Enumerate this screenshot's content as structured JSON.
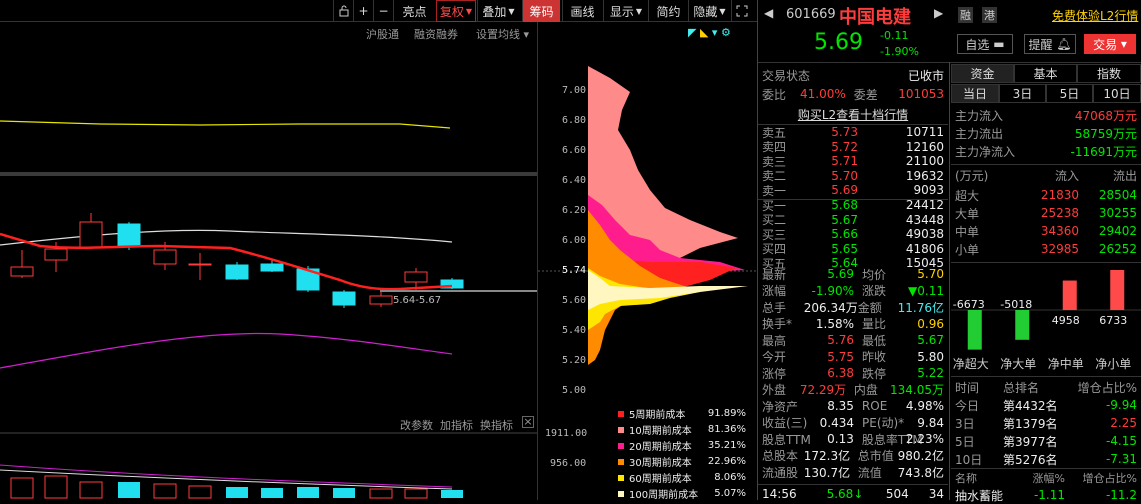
{
  "toolbar": {
    "items": [
      "亮点",
      "复权",
      "叠加",
      "筹码",
      "画线",
      "显示",
      "简约",
      "隐藏"
    ],
    "icons": [
      "lock-icon",
      "plus-icon",
      "minus-icon"
    ]
  },
  "chart_toolbar": [
    "沪股通",
    "融资融券",
    "设置均线"
  ],
  "indicator_toolbar": [
    "改参数",
    "加指标",
    "换指标"
  ],
  "y_ticks": [
    "7.00",
    "6.80",
    "6.60",
    "6.40",
    "6.20",
    "6.00",
    "5.74",
    "5.60",
    "5.40",
    "5.20",
    "5.00"
  ],
  "vol_ticks": [
    "1911.00",
    "956.00"
  ],
  "cost_label": "5.64-5.67",
  "chip_legend": [
    {
      "name": "5周期前成本",
      "value": "91.89%",
      "color": "#ff2020"
    },
    {
      "name": "10周期前成本",
      "value": "81.36%",
      "color": "#ff8a8a"
    },
    {
      "name": "20周期前成本",
      "value": "35.21%",
      "color": "#ff1c8c"
    },
    {
      "name": "30周期前成本",
      "value": "22.96%",
      "color": "#ff8c00"
    },
    {
      "name": "60周期前成本",
      "value": "8.06%",
      "color": "#ffe600"
    },
    {
      "name": "100周期前成本",
      "value": "5.07%",
      "color": "#fff6c0"
    }
  ],
  "stock": {
    "code": "601669",
    "name": "中国电建",
    "price": "5.69",
    "change": "-0.11",
    "pct": "-1.90%",
    "tag1": "融",
    "tag2": "港",
    "l2": "免费体验L2行情"
  },
  "actions": {
    "watch": "自选",
    "alert": "提醒",
    "trade": "交易"
  },
  "status": {
    "label": "交易状态",
    "value": "已收市"
  },
  "ratio": {
    "label1": "委比",
    "value1": "41.00%",
    "label2": "委差",
    "value2": "101053"
  },
  "l2_link": "购买L2查看十档行情",
  "asks": [
    [
      "卖五",
      "5.73",
      "10711"
    ],
    [
      "卖四",
      "5.72",
      "12160"
    ],
    [
      "卖三",
      "5.71",
      "21100"
    ],
    [
      "卖二",
      "5.70",
      "19632"
    ],
    [
      "卖一",
      "5.69",
      "9093"
    ]
  ],
  "bids": [
    [
      "买一",
      "5.68",
      "24412"
    ],
    [
      "买二",
      "5.67",
      "43448"
    ],
    [
      "买三",
      "5.66",
      "49038"
    ],
    [
      "买四",
      "5.65",
      "41806"
    ],
    [
      "买五",
      "5.64",
      "15045"
    ]
  ],
  "quote": [
    [
      "最新",
      "5.69",
      "均价",
      "5.70"
    ],
    [
      "涨幅",
      "-1.90%",
      "涨跌",
      "▼0.11"
    ],
    [
      "总手",
      "206.34万",
      "金额",
      "11.76亿"
    ],
    [
      "换手*",
      "1.58%",
      "量比",
      "0.96"
    ],
    [
      "最高",
      "5.76",
      "最低",
      "5.67"
    ],
    [
      "今开",
      "5.75",
      "昨收",
      "5.80"
    ],
    [
      "涨停",
      "6.38",
      "跌停",
      "5.22"
    ],
    [
      "外盘",
      "72.29万",
      "内盘",
      "134.05万"
    ],
    [
      "净资产",
      "8.35",
      "ROE",
      "4.98%"
    ],
    [
      "收益(三)",
      "0.434",
      "PE(动)*",
      "9.84"
    ],
    [
      "股息TTM",
      "0.13",
      "股息率TTM",
      "2.23%"
    ],
    [
      "总股本",
      "172.3亿",
      "总市值",
      "980.2亿"
    ],
    [
      "流通股",
      "130.7亿",
      "流值",
      "743.8亿"
    ]
  ],
  "last_tick": {
    "time": "14:56",
    "price": "5.68",
    "vol": "504",
    "count": "34"
  },
  "fund_tabs": [
    "资金",
    "基本",
    "指数"
  ],
  "period_tabs": [
    "当日",
    "3日",
    "5日",
    "10日"
  ],
  "main_flow": [
    [
      "主力流入",
      "47068万元"
    ],
    [
      "主力流出",
      "58759万元"
    ],
    [
      "主力净流入",
      "-11691万元"
    ]
  ],
  "flow_table": {
    "unit": "(万元)",
    "in": "流入",
    "out": "流出",
    "rows": [
      [
        "超大",
        "21830",
        "28504"
      ],
      [
        "大单",
        "25238",
        "30255"
      ],
      [
        "中单",
        "34360",
        "29402"
      ],
      [
        "小单",
        "32985",
        "26252"
      ]
    ]
  },
  "net_bars": {
    "values": [
      -6673,
      -5018,
      4958,
      6733
    ],
    "labels": [
      "-6673",
      "-5018",
      "4958",
      "6733"
    ],
    "names": [
      "净超大",
      "净大单",
      "净中单",
      "净小单"
    ]
  },
  "rank": {
    "headers": [
      "时间",
      "总排名",
      "增仓占比%"
    ],
    "rows": [
      [
        "今日",
        "第4432名",
        "-9.94"
      ],
      [
        "3日",
        "第1379名",
        "2.25"
      ],
      [
        "5日",
        "第3977名",
        "-4.15"
      ],
      [
        "10日",
        "第5276名",
        "-7.31"
      ]
    ]
  },
  "sector": {
    "headers": [
      "名称",
      "涨幅%",
      "增仓占比%"
    ],
    "row": [
      "抽水蓄能",
      "-1.11",
      "-11.2"
    ]
  }
}
